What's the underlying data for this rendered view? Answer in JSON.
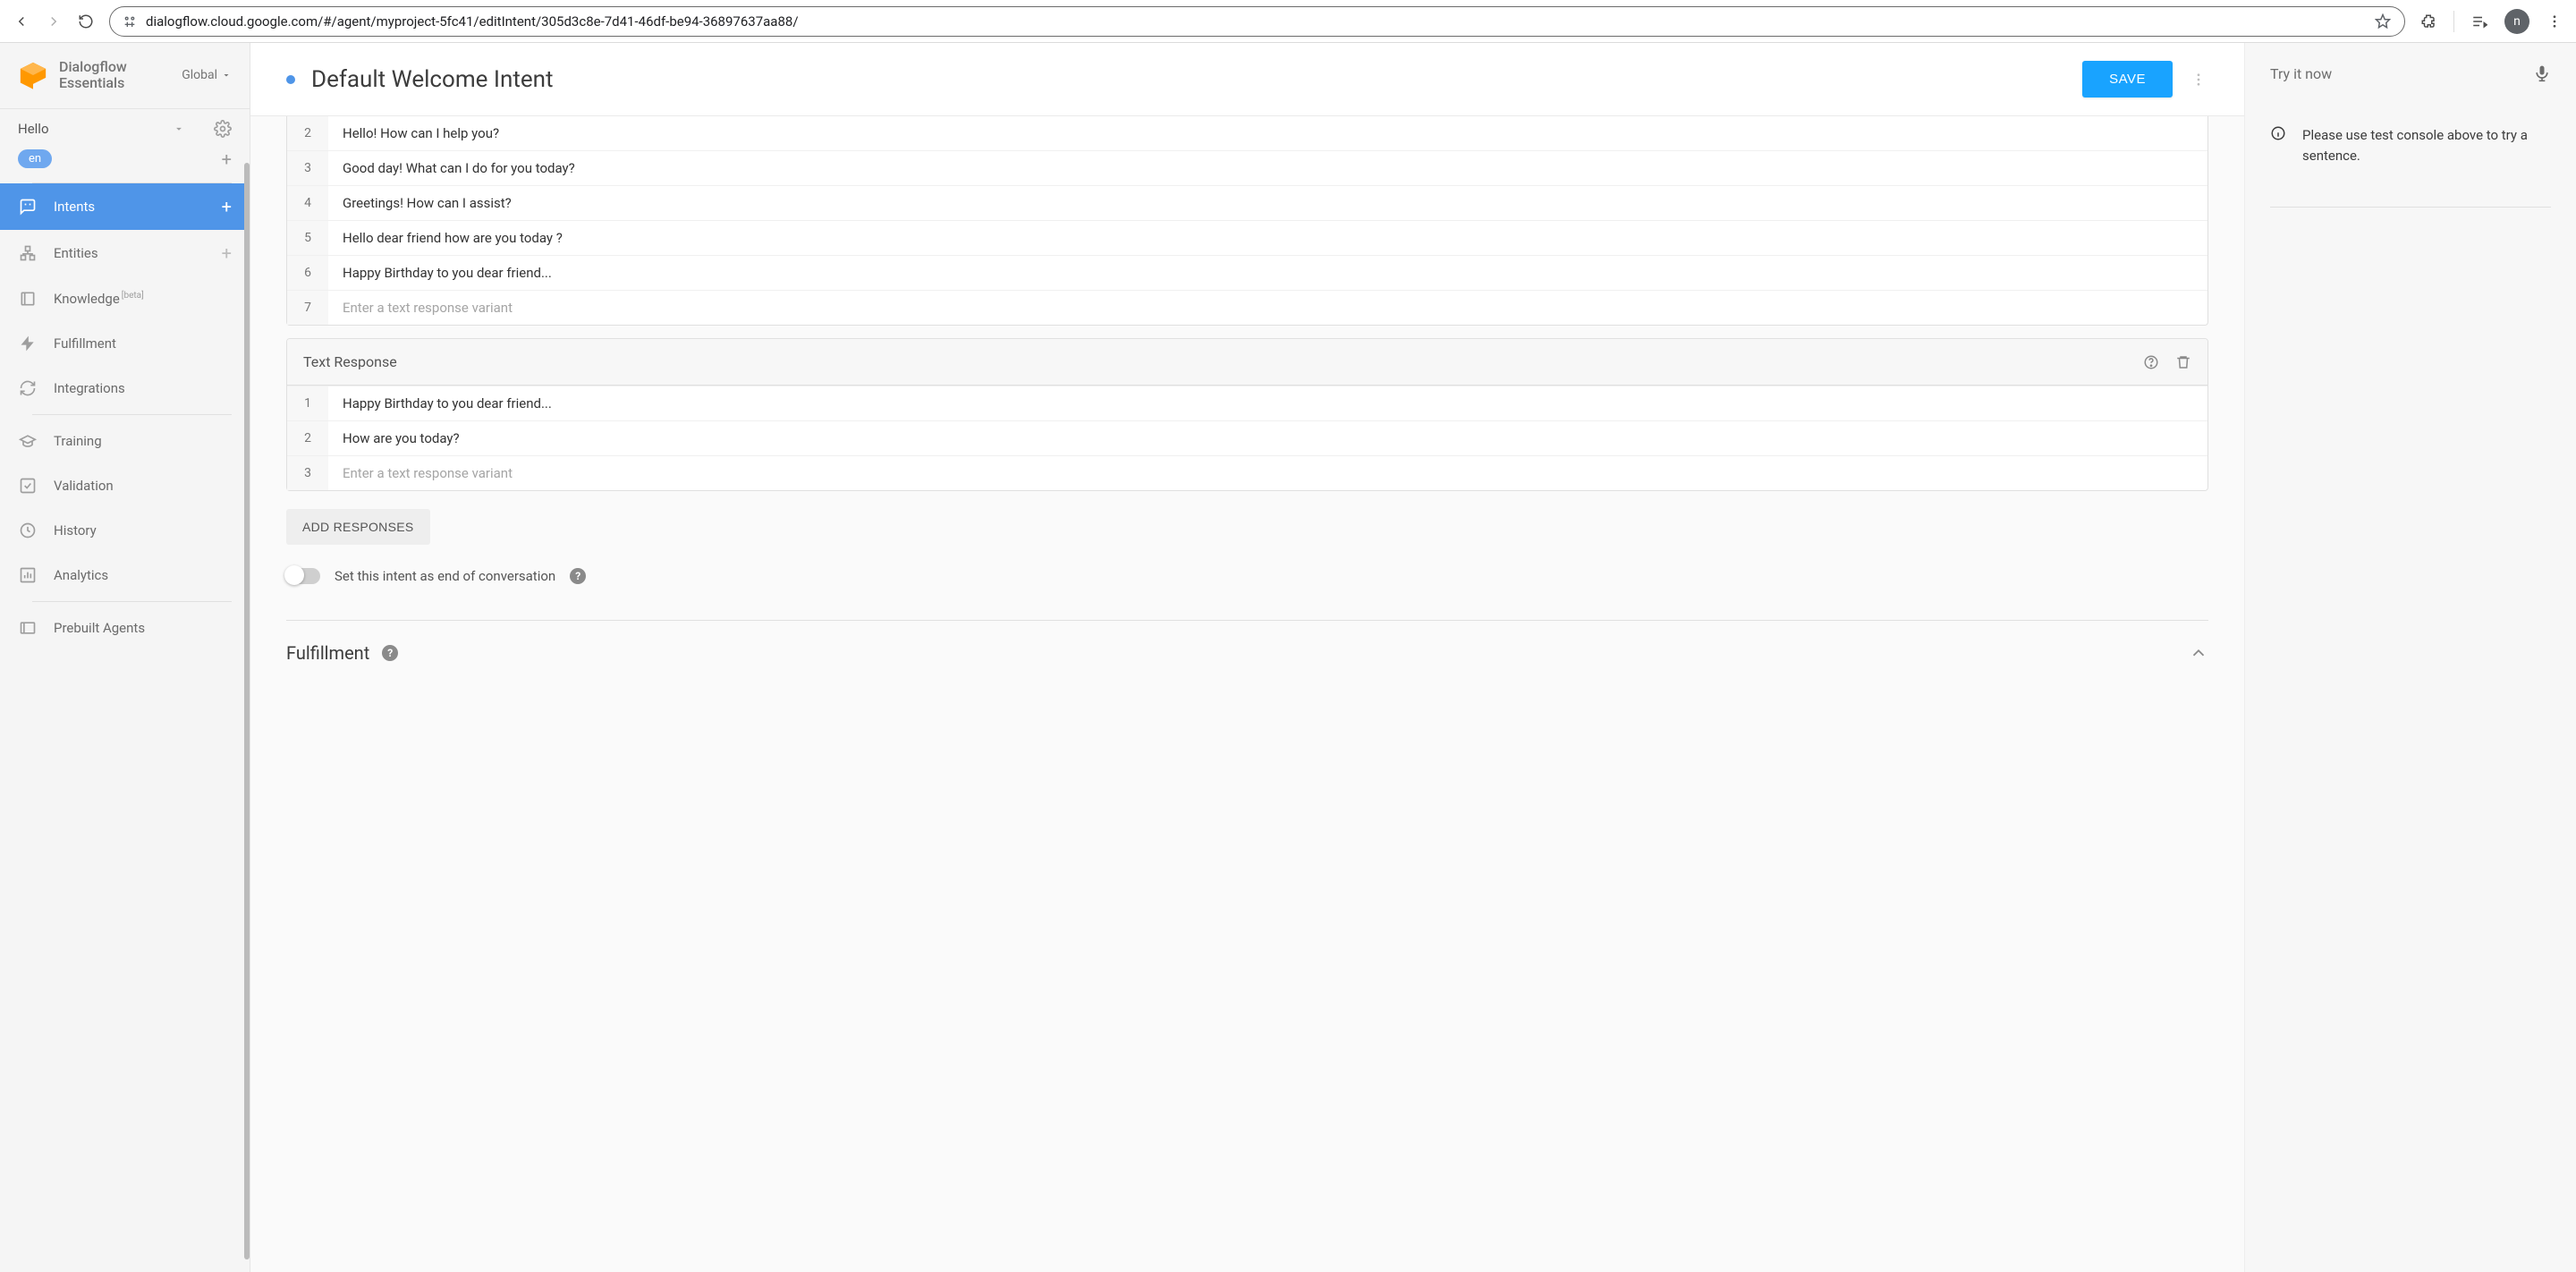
{
  "browser": {
    "url": "dialogflow.cloud.google.com/#/agent/myproject-5fc41/editIntent/305d3c8e-7d41-46df-be94-36897637aa88/",
    "profile_initial": "n"
  },
  "brand": {
    "line1": "Dialogflow",
    "line2": "Essentials",
    "region_label": "Global"
  },
  "agent": {
    "name": "Hello",
    "lang": "en"
  },
  "sidebar": {
    "items": [
      {
        "label": "Intents",
        "add": true,
        "active": true
      },
      {
        "label": "Entities",
        "add": true,
        "active": false
      },
      {
        "label": "Knowledge",
        "beta": "[beta]",
        "active": false
      },
      {
        "label": "Fulfillment",
        "active": false
      },
      {
        "label": "Integrations",
        "active": false
      },
      {
        "label": "Training",
        "active": false
      },
      {
        "label": "Validation",
        "active": false
      },
      {
        "label": "History",
        "active": false
      },
      {
        "label": "Analytics",
        "active": false
      },
      {
        "label": "Prebuilt Agents",
        "active": false
      }
    ]
  },
  "header": {
    "title": "Default Welcome Intent",
    "save_label": "SAVE"
  },
  "responses": {
    "block1": {
      "rows": [
        {
          "n": "2",
          "text": "Hello! How can I help you?"
        },
        {
          "n": "3",
          "text": "Good day! What can I do for you today?"
        },
        {
          "n": "4",
          "text": "Greetings! How can I assist?"
        },
        {
          "n": "5",
          "text": "Hello dear friend how are you today ?"
        },
        {
          "n": "6",
          "text": "Happy Birthday to you dear friend..."
        }
      ],
      "placeholder_n": "7",
      "placeholder_text": "Enter a text response variant"
    },
    "block2": {
      "title": "Text Response",
      "rows": [
        {
          "n": "1",
          "text": "Happy Birthday to you dear friend..."
        },
        {
          "n": "2",
          "text": "How are you today?"
        }
      ],
      "placeholder_n": "3",
      "placeholder_text": "Enter a text response variant"
    },
    "add_responses_label": "ADD RESPONSES",
    "end_convo_label": "Set this intent as end of conversation"
  },
  "fulfillment": {
    "title": "Fulfillment"
  },
  "try": {
    "title": "Try it now",
    "info_text": "Please use test console above to try a sentence."
  }
}
